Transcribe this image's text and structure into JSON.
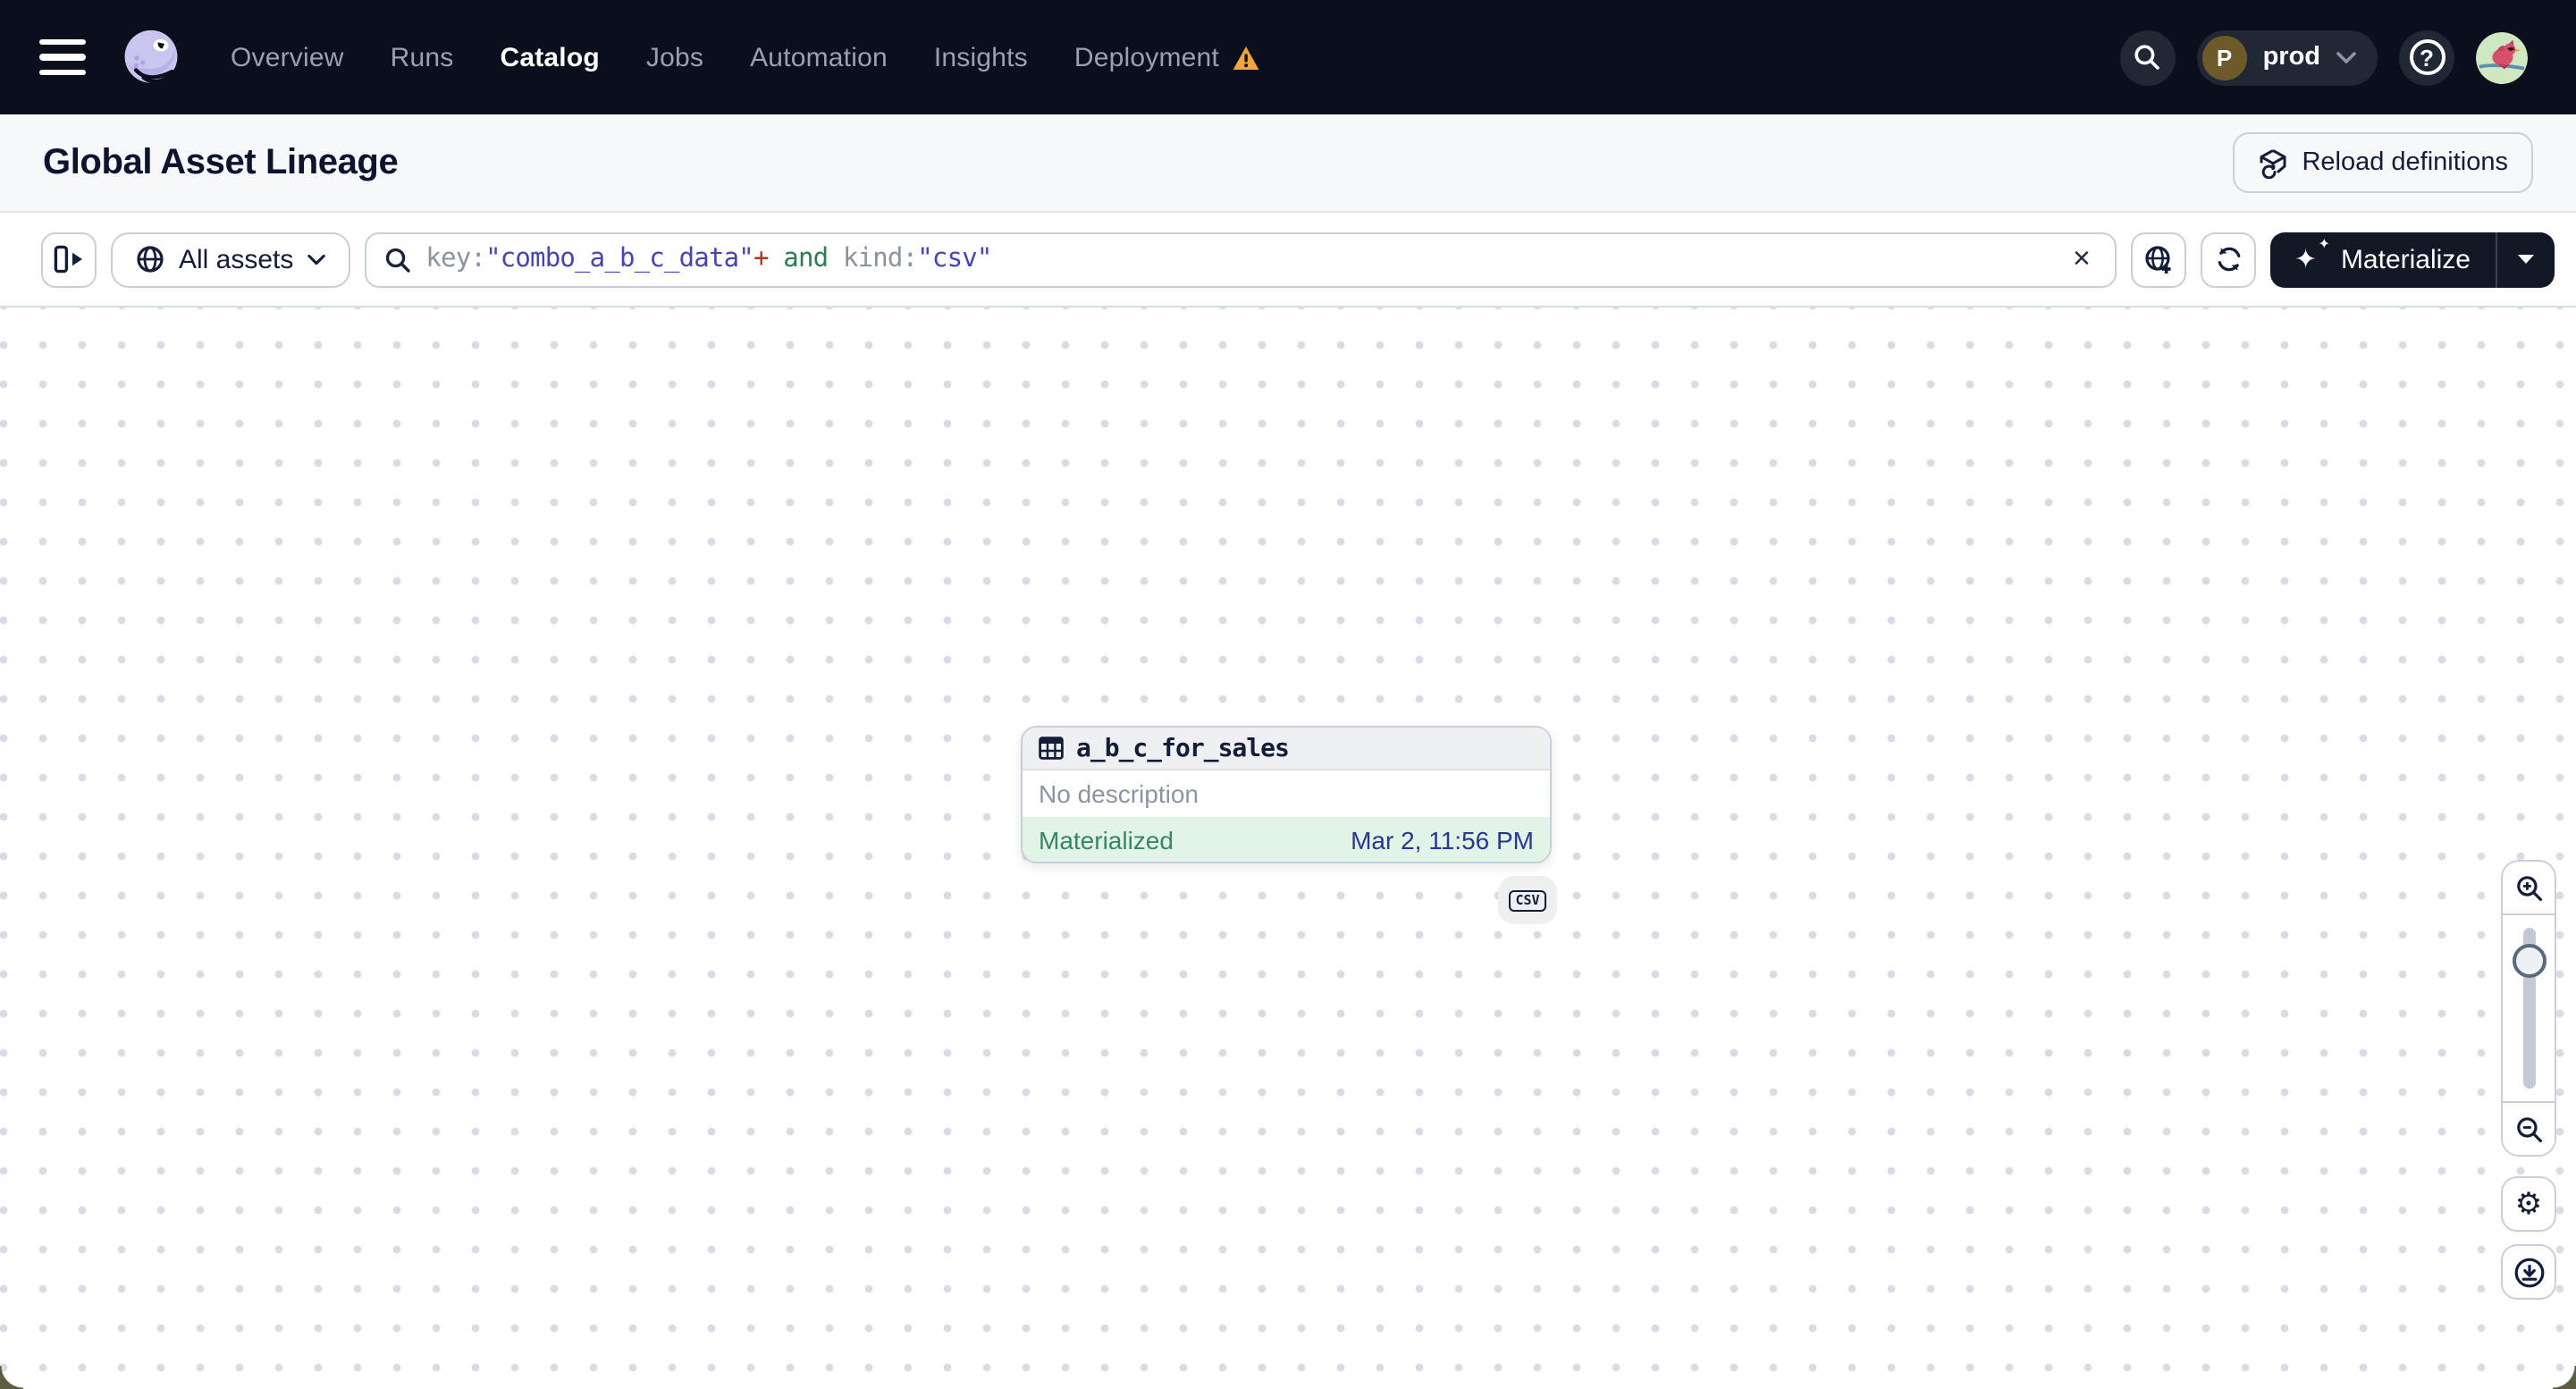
{
  "nav": {
    "items": [
      {
        "label": "Overview",
        "active": false
      },
      {
        "label": "Runs",
        "active": false
      },
      {
        "label": "Catalog",
        "active": true
      },
      {
        "label": "Jobs",
        "active": false
      },
      {
        "label": "Automation",
        "active": false
      },
      {
        "label": "Insights",
        "active": false
      },
      {
        "label": "Deployment",
        "active": false,
        "warning": true
      }
    ],
    "environment": {
      "initial": "P",
      "name": "prod"
    },
    "help_label": "?"
  },
  "header": {
    "title": "Global Asset Lineage",
    "reload_button_label": "Reload definitions"
  },
  "toolbar": {
    "scope_label": "All assets",
    "search": {
      "tokens": [
        {
          "text": "key:",
          "type": "field"
        },
        {
          "text": "\"combo_a_b_c_data\"",
          "type": "string"
        },
        {
          "text": "+",
          "type": "operator"
        },
        {
          "text": " and ",
          "type": "keyword"
        },
        {
          "text": "kind:",
          "type": "field"
        },
        {
          "text": "\"csv\"",
          "type": "string"
        }
      ]
    },
    "materialize_label": "Materialize"
  },
  "graph": {
    "node": {
      "title": "a_b_c_for_sales",
      "description": "No description",
      "status": "Materialized",
      "status_time": "Mar 2, 11:56 PM",
      "kind_badge": "CSV"
    }
  },
  "colors": {
    "navbar_bg": "#0b0e1c",
    "nav_active_text": "#ffffff",
    "nav_inactive_text": "#99a0b0",
    "warning_orange": "#efa63e",
    "header_bg": "#f7f8fa",
    "accent_dark_button": "#131827",
    "search_string": "#4745b4",
    "search_operator": "#a03c1a",
    "search_keyword": "#2b7e50",
    "search_field": "#8b93a1",
    "materialized_green_bg": "#e2f4e8",
    "materialized_green_text": "#39875d",
    "timestamp_indigo": "#2b3690",
    "grid_dot": "#d9dce4"
  }
}
